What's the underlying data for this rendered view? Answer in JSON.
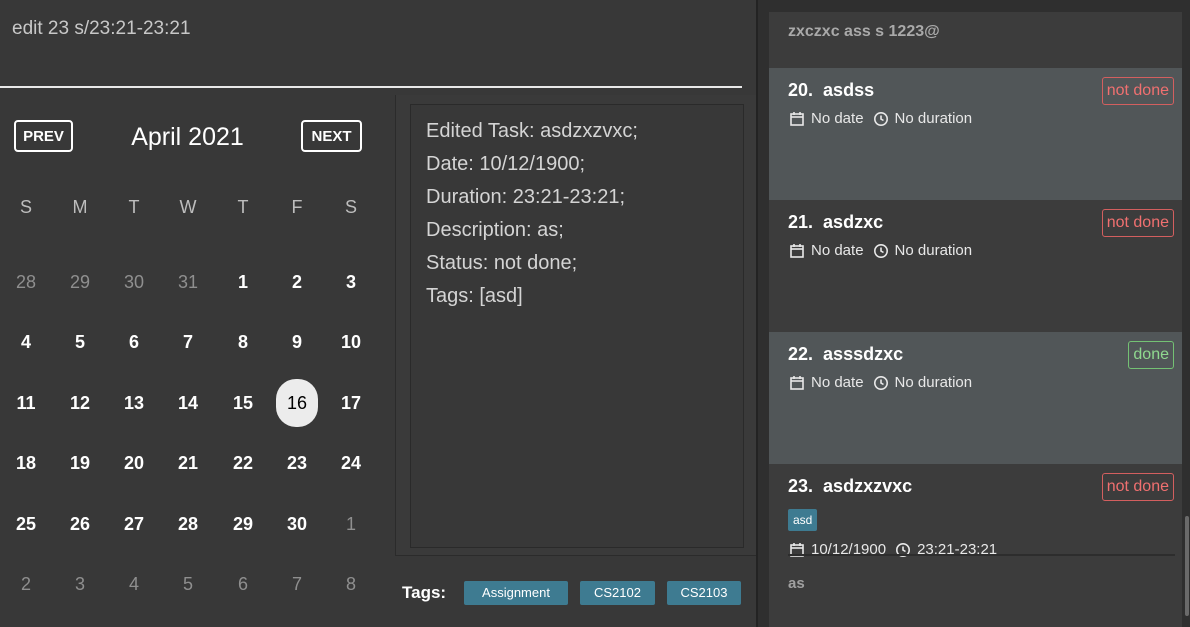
{
  "command": {
    "value": "edit 23 s/23:21-23:21"
  },
  "calendar": {
    "prev_label": "PREV",
    "next_label": "NEXT",
    "month_title": "April 2021",
    "weekdays": [
      "S",
      "M",
      "T",
      "W",
      "T",
      "F",
      "S"
    ],
    "weeks": [
      [
        {
          "d": "28",
          "dim": true
        },
        {
          "d": "29",
          "dim": true
        },
        {
          "d": "30",
          "dim": true
        },
        {
          "d": "31",
          "dim": true
        },
        {
          "d": "1"
        },
        {
          "d": "2"
        },
        {
          "d": "3"
        }
      ],
      [
        {
          "d": "4"
        },
        {
          "d": "5"
        },
        {
          "d": "6"
        },
        {
          "d": "7"
        },
        {
          "d": "8"
        },
        {
          "d": "9"
        },
        {
          "d": "10"
        }
      ],
      [
        {
          "d": "11"
        },
        {
          "d": "12"
        },
        {
          "d": "13"
        },
        {
          "d": "14"
        },
        {
          "d": "15"
        },
        {
          "d": "16",
          "today": true
        },
        {
          "d": "17"
        }
      ],
      [
        {
          "d": "18"
        },
        {
          "d": "19"
        },
        {
          "d": "20"
        },
        {
          "d": "21"
        },
        {
          "d": "22"
        },
        {
          "d": "23"
        },
        {
          "d": "24"
        }
      ],
      [
        {
          "d": "25"
        },
        {
          "d": "26"
        },
        {
          "d": "27"
        },
        {
          "d": "28"
        },
        {
          "d": "29"
        },
        {
          "d": "30"
        },
        {
          "d": "1",
          "dim": true
        }
      ],
      [
        {
          "d": "2",
          "dim": true
        },
        {
          "d": "3",
          "dim": true
        },
        {
          "d": "4",
          "dim": true
        },
        {
          "d": "5",
          "dim": true
        },
        {
          "d": "6",
          "dim": true
        },
        {
          "d": "7",
          "dim": true
        },
        {
          "d": "8",
          "dim": true
        }
      ]
    ]
  },
  "result": {
    "lines": [
      "Edited Task: asdzxzvxc;",
      "Date: 10/12/1900;",
      "Duration: 23:21-23:21;",
      "Description: as;",
      "Status: not done;",
      "Tags: [asd]"
    ]
  },
  "tags_bar": {
    "label": "Tags:",
    "tags": [
      "Assignment",
      "CS2102",
      "CS2103"
    ]
  },
  "task_list": {
    "header": "zxczxc ass s 1223@",
    "tasks": [
      {
        "index": "20.",
        "name": "asdss",
        "status": "not done",
        "date": "No date",
        "duration": "No duration"
      },
      {
        "index": "21.",
        "name": "asdzxc",
        "status": "not done",
        "date": "No date",
        "duration": "No duration"
      },
      {
        "index": "22.",
        "name": "asssdzxc",
        "status": "done",
        "date": "No date",
        "duration": "No duration"
      },
      {
        "index": "23.",
        "name": "asdzxzvxc",
        "status": "not done",
        "tag": "asd",
        "date": "10/12/1900",
        "duration": "23:21-23:21",
        "description": "as"
      }
    ]
  },
  "colors": {
    "status_not_done": "#f07070",
    "status_done": "#8fd88f",
    "tag_bg": "#3e7b91",
    "today_bg": "#ececec"
  },
  "icons": {
    "date": "calendar-icon",
    "duration": "clock-icon"
  }
}
